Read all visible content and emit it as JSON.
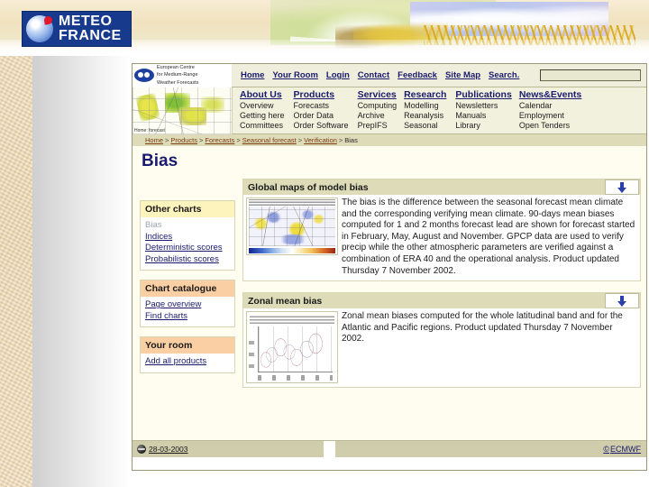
{
  "brand": {
    "meteo_line1": "METEO",
    "meteo_line2": "FRANCE",
    "ecmwf_line1": "European Centre",
    "ecmwf_line2": "for Medium-Range",
    "ecmwf_line3": "Weather Forecasts",
    "thumb_caption": "Home: forecast"
  },
  "topnav": {
    "links": [
      "Home",
      "Your Room",
      "Login",
      "Contact",
      "Feedback",
      "Site Map",
      "Search."
    ],
    "search_value": "",
    "search_placeholder": ""
  },
  "navcolumns": [
    {
      "head": "About Us",
      "items": [
        "Overview",
        "Getting here",
        "Committees"
      ]
    },
    {
      "head": "Products",
      "items": [
        "Forecasts",
        "Order Data",
        "Order Software"
      ]
    },
    {
      "head": "Services",
      "items": [
        "Computing",
        "Archive",
        "PrepIFS"
      ]
    },
    {
      "head": "Research",
      "items": [
        "Modelling",
        "Reanalysis",
        "Seasonal"
      ]
    },
    {
      "head": "Publications",
      "items": [
        "Newsletters",
        "Manuals",
        "Library"
      ]
    },
    {
      "head": "News&Events",
      "items": [
        "Calendar",
        "Employment",
        "Open Tenders"
      ]
    }
  ],
  "breadcrumb": {
    "items": [
      "Home",
      "Products",
      "Forecasts",
      "Seasonal forecast",
      "Verification"
    ],
    "current": "Bias",
    "separator": ">"
  },
  "page": {
    "title": "Bias"
  },
  "sidebar": {
    "panels": [
      {
        "head": "Other charts",
        "head_color": "#fdf3bd",
        "links": [
          {
            "label": "Bias",
            "active": true
          },
          {
            "label": "Indices",
            "active": false
          },
          {
            "label": "Deterministic scores",
            "active": false
          },
          {
            "label": "Probabilistic scores",
            "active": false
          }
        ]
      },
      {
        "head": "Chart catalogue",
        "head_color": "#fbcfa4",
        "links": [
          {
            "label": "Page overview",
            "active": false
          },
          {
            "label": "Find charts",
            "active": false
          }
        ]
      },
      {
        "head": "Your room",
        "head_color": "#fbcfa4",
        "links": [
          {
            "label": "Add all products",
            "active": false
          }
        ]
      }
    ]
  },
  "cards": [
    {
      "title": "Global maps of model bias",
      "download_icon": "download-arrow-icon",
      "thumb_alt": "global-bias-map-thumbnail",
      "text": "The bias is the difference between the seasonal forecast mean climate and the corresponding verifying mean climate. 90-days mean biases computed for 1 and 2 months forecast lead are shown for forecast started in February, May, August and November. GPCP data are used to verify precip while the other atmospheric parameters are verified against a combination of ERA 40 and the operational analysis. Product updated Thursday 7 November 2002."
    },
    {
      "title": "Zonal mean bias",
      "download_icon": "download-arrow-icon",
      "thumb_alt": "zonal-mean-bias-plot-thumbnail",
      "text": "Zonal mean biases computed for the whole latitudinal band and for the Atlantic and Pacific regions. Product updated Thursday 7 November 2002."
    }
  ],
  "footer": {
    "date": "28-03-2003",
    "copyright": "ECMWF",
    "copyright_symbol": "©"
  },
  "colors": {
    "nav_band": "#f2f1dd",
    "breadcrumb_bar": "#dedcb8",
    "card_head": "#dedcb8",
    "panel_yellow": "#fdf3bd",
    "panel_orange": "#fbcfa4",
    "link_blue": "#1a1a6e",
    "footer_bar": "#cfcdab",
    "meteo_blue": "#173a8c"
  }
}
